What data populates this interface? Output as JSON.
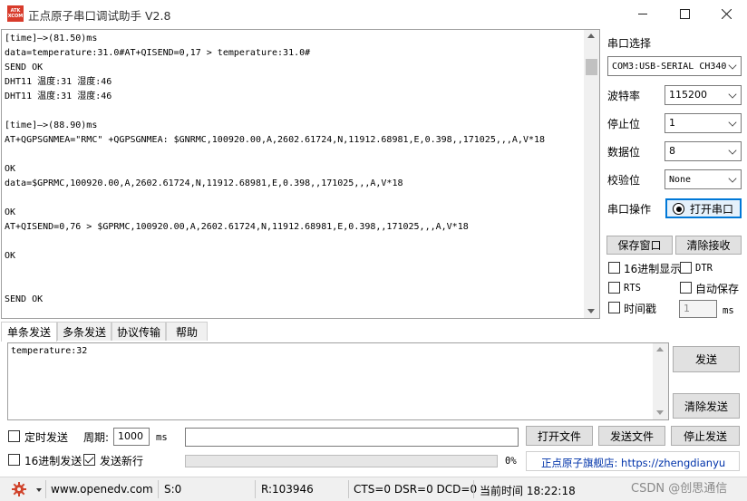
{
  "app": {
    "title": "正点原子串口调试助手 V2.8",
    "logo_text": "ATK XCOM"
  },
  "receive": {
    "lines": [
      "[time]—>(81.50)ms",
      "data=temperature:31.0#AT+QISEND=0,17 > temperature:31.0#",
      "SEND OK",
      "DHT11 温度:31 湿度:46",
      "DHT11 温度:31 湿度:46",
      "",
      "[time]—>(88.90)ms",
      "AT+QGPSGNMEA=\"RMC\" +QGPSGNMEA: $GNRMC,100920.00,A,2602.61724,N,11912.68981,E,0.398,,171025,,,A,V*18",
      "",
      "OK",
      "data=$GPRMC,100920.00,A,2602.61724,N,11912.68981,E,0.398,,171025,,,A,V*18",
      "",
      "OK",
      "AT+QISEND=0,76 > $GPRMC,100920.00,A,2602.61724,N,11912.68981,E,0.398,,171025,,,A,V*18",
      "",
      "OK",
      "",
      "",
      "SEND OK"
    ]
  },
  "settings": {
    "port_label": "串口选择",
    "port_value": "COM3:USB-SERIAL CH340",
    "baud_label": "波特率",
    "baud_value": "115200",
    "stop_label": "停止位",
    "stop_value": "1",
    "data_label": "数据位",
    "data_value": "8",
    "parity_label": "校验位",
    "parity_value": "None",
    "op_label": "串口操作",
    "open_button": "打开串口",
    "save_window": "保存窗口",
    "clear_receive": "清除接收",
    "hex_display": "16进制显示",
    "dtr": "DTR",
    "rts": "RTS",
    "auto_save": "自动保存",
    "timestamp": "时间戳",
    "timestamp_value": "1",
    "timestamp_unit": "ms"
  },
  "tabs": [
    "单条发送",
    "多条发送",
    "协议传输",
    "帮助"
  ],
  "send": {
    "text": "temperature:32",
    "send_button": "发送",
    "clear_send_button": "清除发送",
    "timed_send": "定时发送",
    "period_label": "周期:",
    "period_value": "1000",
    "period_unit": "ms",
    "open_file": "打开文件",
    "send_file": "发送文件",
    "stop_send": "停止发送",
    "hex_send": "16进制发送",
    "send_newline": "发送新行",
    "progress_text": "0%",
    "progress": 0,
    "link_text": "正点原子旗舰店: https://zhengdianyu"
  },
  "status": {
    "website": "www.openedv.com",
    "sent": "S:0",
    "received": "R:103946",
    "lines": "CTS=0 DSR=0 DCD=0",
    "time": "当前时间 18:22:18"
  },
  "watermark": "CSDN @创思通信",
  "colors": {
    "accent": "#0078d7",
    "logo_red": "#d83b2b",
    "link_blue": "#0033aa"
  }
}
